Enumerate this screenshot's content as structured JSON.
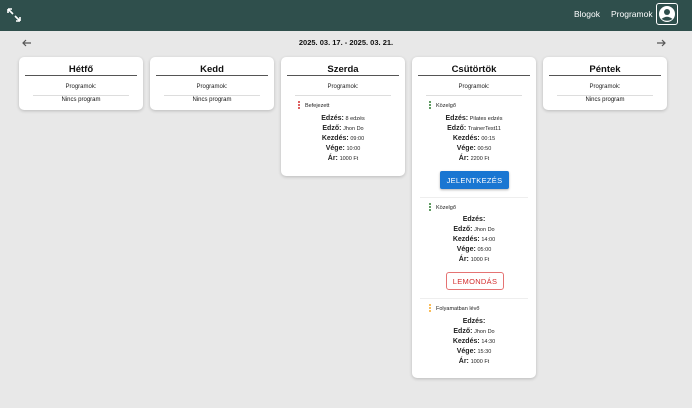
{
  "header": {
    "nav_blogs": "Blogok",
    "nav_programs": "Programok",
    "bg_color": "#2f4f4c",
    "expand_icon": "expand-icon",
    "account_icon": "account-circle-icon"
  },
  "week": {
    "range": "2025. 03. 17. - 2025. 03. 21.",
    "prev_icon": "arrow-left-icon",
    "next_icon": "arrow-right-icon"
  },
  "days": [
    {
      "name": "Hétfő",
      "programs_label": "Programok:",
      "empty_label": "Nincs program"
    },
    {
      "name": "Kedd",
      "programs_label": "Programok:",
      "empty_label": "Nincs program"
    },
    {
      "name": "Szerda",
      "programs_label": "Programok:",
      "programs": [
        {
          "status": "Befejezett",
          "status_color": "#d32f2f",
          "edzes_label": "Edzés:",
          "edzes": "8 edzés",
          "edzo_label": "Edző:",
          "edzo": "Jhon Do",
          "kezdes_label": "Kezdés:",
          "kezdes": "09:00",
          "vege_label": "Vége:",
          "vege": "10:00",
          "ar_label": "Ár:",
          "ar": "1000 Ft"
        }
      ]
    },
    {
      "name": "Csütörtök",
      "programs_label": "Programok:",
      "programs": [
        {
          "status": "Közelgő",
          "status_color": "#2e7d32",
          "edzes_label": "Edzés:",
          "edzes": "Pilates edzés",
          "edzo_label": "Edző:",
          "edzo": "TrainerTest11",
          "kezdes_label": "Kezdés:",
          "kezdes": "00:15",
          "vege_label": "Vége:",
          "vege": "00:50",
          "ar_label": "Ár:",
          "ar": "2200 Ft",
          "button": "JELENTKEZÉS"
        },
        {
          "status": "Közelgő",
          "status_color": "#2e7d32",
          "edzes_label": "Edzés:",
          "edzes": "",
          "edzo_label": "Edző:",
          "edzo": "Jhon Do",
          "kezdes_label": "Kezdés:",
          "kezdes": "14:00",
          "vege_label": "Vége:",
          "vege": "05:00",
          "ar_label": "Ár:",
          "ar": "1000 Ft",
          "button": "LEMONDÁS"
        },
        {
          "status": "Folyamatban lévő",
          "status_color": "#f9a825",
          "edzes_label": "Edzés:",
          "edzes": "",
          "edzo_label": "Edző:",
          "edzo": "Jhon Do",
          "kezdes_label": "Kezdés:",
          "kezdes": "14:30",
          "vege_label": "Vége:",
          "vege": "15:30",
          "ar_label": "Ár:",
          "ar": "1000 Ft"
        }
      ]
    },
    {
      "name": "Péntek",
      "programs_label": "Programok:",
      "empty_label": "Nincs program"
    }
  ]
}
